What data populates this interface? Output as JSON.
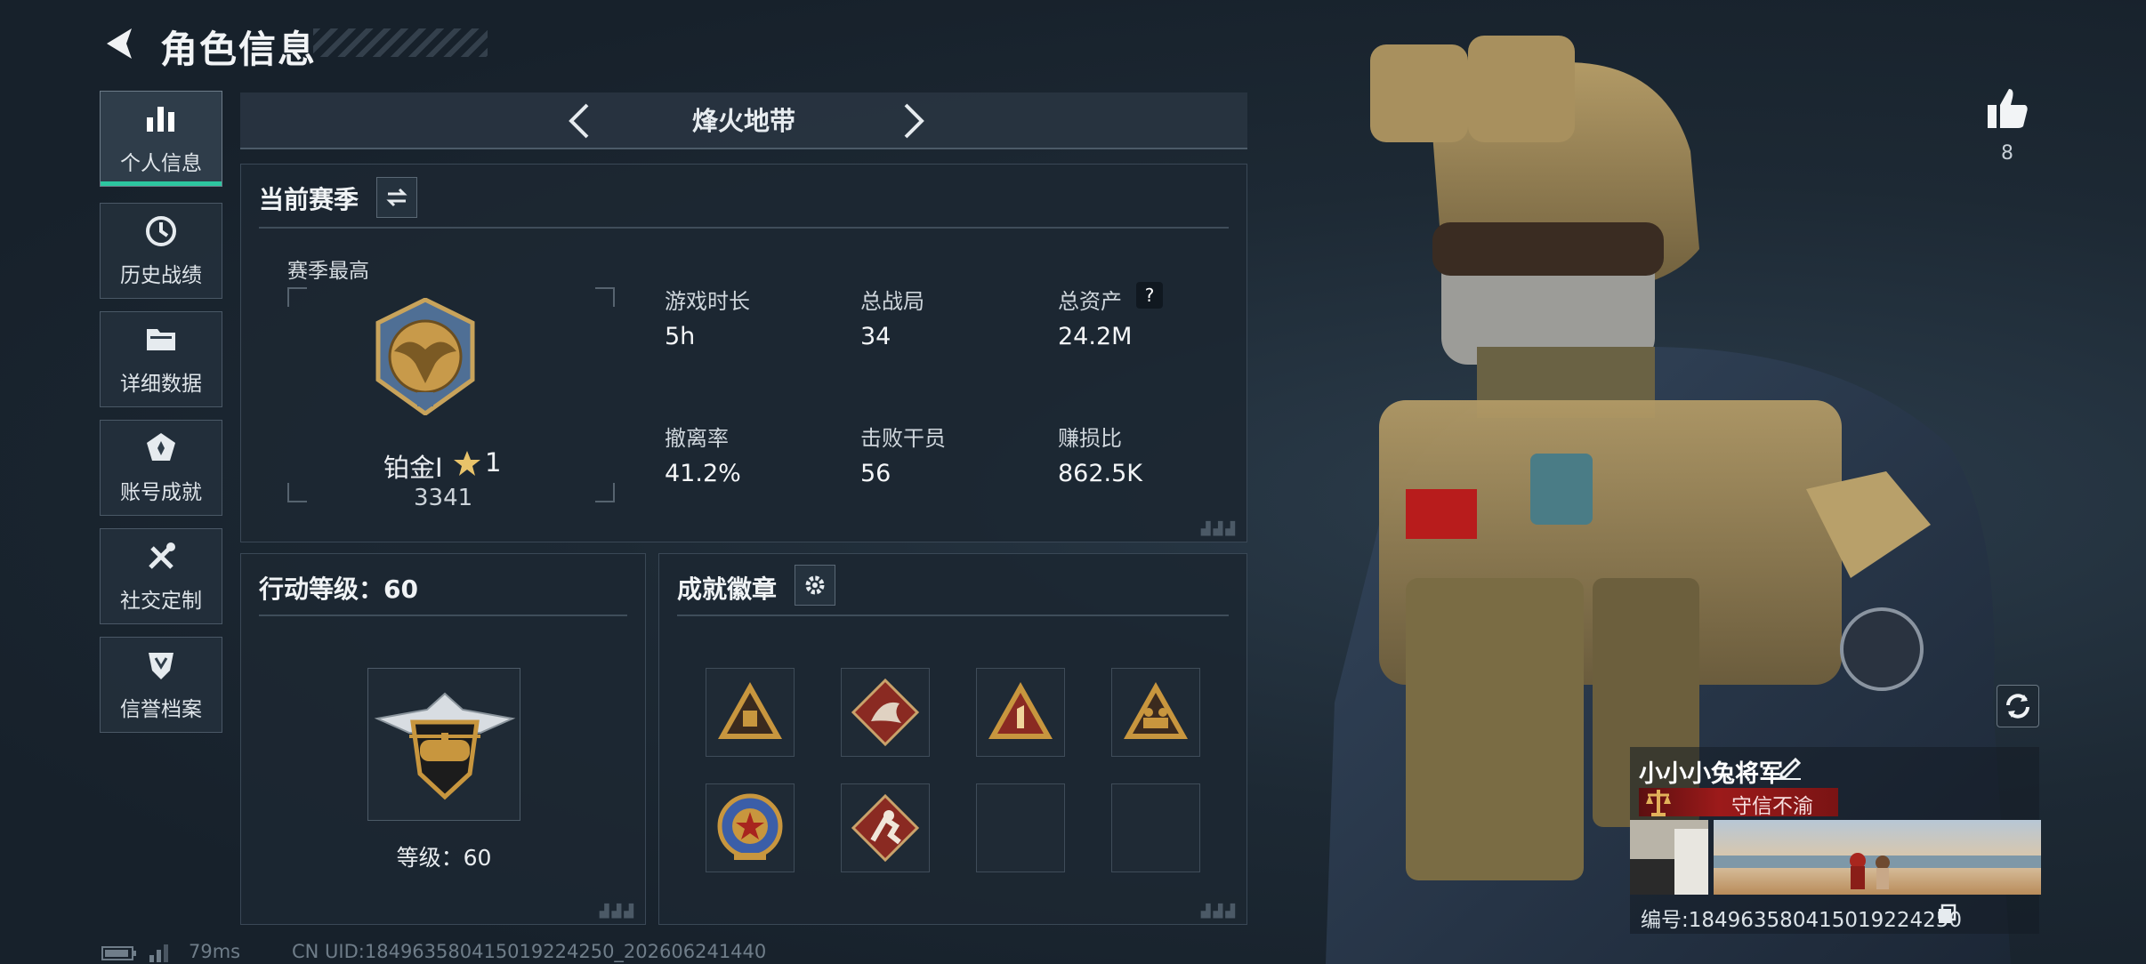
{
  "header": {
    "title": "角色信息"
  },
  "sidebar": {
    "items": [
      {
        "label": "个人信息",
        "icon": "bar-chart-icon",
        "active": true
      },
      {
        "label": "历史战绩",
        "icon": "history-icon"
      },
      {
        "label": "详细数据",
        "icon": "folder-icon"
      },
      {
        "label": "账号成就",
        "icon": "achievement-icon"
      },
      {
        "label": "社交定制",
        "icon": "tools-icon"
      },
      {
        "label": "信誉档案",
        "icon": "credit-shield-icon"
      }
    ]
  },
  "mode": {
    "title": "烽火地带"
  },
  "season": {
    "title": "当前赛季",
    "best_label": "赛季最高",
    "rank_name": "铂金I",
    "rank_stars": "1",
    "rank_points": "3341",
    "stats": [
      {
        "label": "游戏时长",
        "value": "5h"
      },
      {
        "label": "总战局",
        "value": "34"
      },
      {
        "label": "总资产",
        "value": "24.2M"
      },
      {
        "label": "撤离率",
        "value": "41.2%"
      },
      {
        "label": "击败干员",
        "value": "56"
      },
      {
        "label": "赚损比",
        "value": "862.5K"
      }
    ]
  },
  "action_level": {
    "title": "行动等级：60",
    "level_text": "等级：60"
  },
  "achievements": {
    "title": "成就徽章"
  },
  "profile": {
    "likes": "8",
    "nickname": "小小小兔将军",
    "honor_title": "守信不渝",
    "id_line": "编号:184963580415019224250"
  },
  "status_bar": {
    "ping": "79ms",
    "uid": "CN UID:184963580415019224250_202606241440"
  },
  "colors": {
    "accent": "#2cc6a0",
    "honor_red": "#9c1a1a",
    "badge_gold": "#c8963e"
  }
}
